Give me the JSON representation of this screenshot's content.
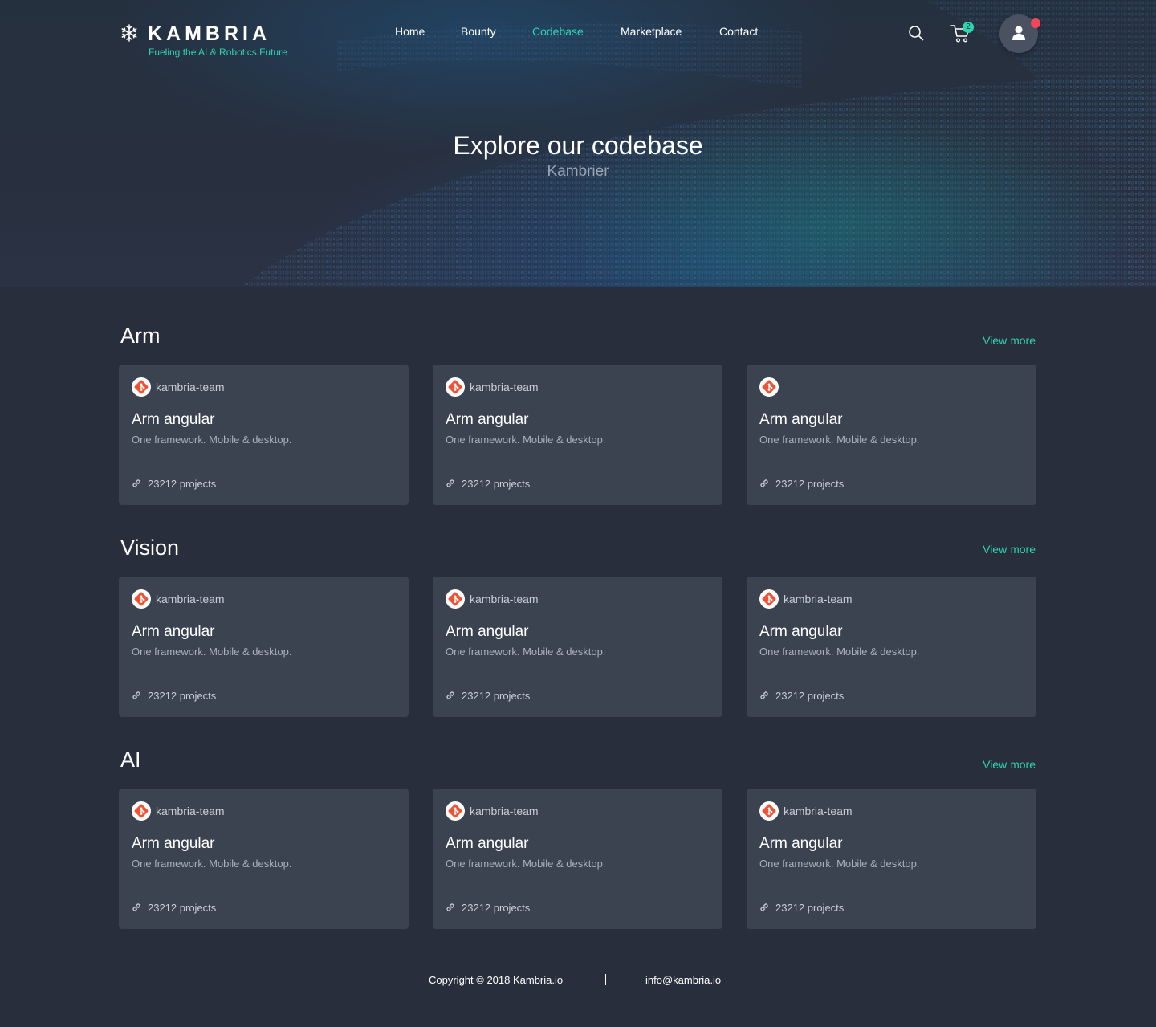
{
  "brand": {
    "name": "KAMBRIA",
    "tagline": "Fueling the AI & Robotics Future"
  },
  "nav": {
    "items": [
      {
        "label": "Home",
        "active": false
      },
      {
        "label": "Bounty",
        "active": false
      },
      {
        "label": "Codebase",
        "active": true
      },
      {
        "label": "Marketplace",
        "active": false
      },
      {
        "label": "Contact",
        "active": false
      }
    ]
  },
  "header": {
    "cart_count": "2",
    "icons": [
      "search-icon",
      "cart-icon",
      "user-icon"
    ]
  },
  "hero": {
    "title": "Explore our codebase",
    "subtitle": "Kambrier"
  },
  "sections": [
    {
      "title": "Arm",
      "view_more": "View more",
      "cards": [
        {
          "owner": "kambria-team",
          "name": "Arm angular",
          "desc": "One framework. Mobile & desktop.",
          "count": "23212 projects"
        },
        {
          "owner": "kambria-team",
          "name": "Arm angular",
          "desc": "One framework. Mobile & desktop.",
          "count": "23212 projects"
        },
        {
          "owner": "",
          "name": "Arm angular",
          "desc": "One framework. Mobile & desktop.",
          "count": "23212 projects"
        }
      ]
    },
    {
      "title": "Vision",
      "view_more": "View more",
      "cards": [
        {
          "owner": "kambria-team",
          "name": "Arm angular",
          "desc": "One framework. Mobile & desktop.",
          "count": "23212 projects"
        },
        {
          "owner": "kambria-team",
          "name": "Arm angular",
          "desc": "One framework. Mobile & desktop.",
          "count": "23212 projects"
        },
        {
          "owner": "kambria-team",
          "name": "Arm angular",
          "desc": "One framework. Mobile & desktop.",
          "count": "23212 projects"
        }
      ]
    },
    {
      "title": "AI",
      "view_more": "View more",
      "cards": [
        {
          "owner": "kambria-team",
          "name": "Arm angular",
          "desc": "One framework. Mobile & desktop.",
          "count": "23212 projects"
        },
        {
          "owner": "kambria-team",
          "name": "Arm angular",
          "desc": "One framework. Mobile & desktop.",
          "count": "23212 projects"
        },
        {
          "owner": "kambria-team",
          "name": "Arm angular",
          "desc": "One framework. Mobile & desktop.",
          "count": "23212 projects"
        }
      ]
    }
  ],
  "footer": {
    "copyright": "Copyright © 2018 Kambria.io",
    "email": "info@kambria.io"
  },
  "colors": {
    "background": "#282e3b",
    "card": "#3b4250",
    "accent": "#2ed3b0",
    "git_icon": "#f05133",
    "notification": "#f2465a"
  }
}
